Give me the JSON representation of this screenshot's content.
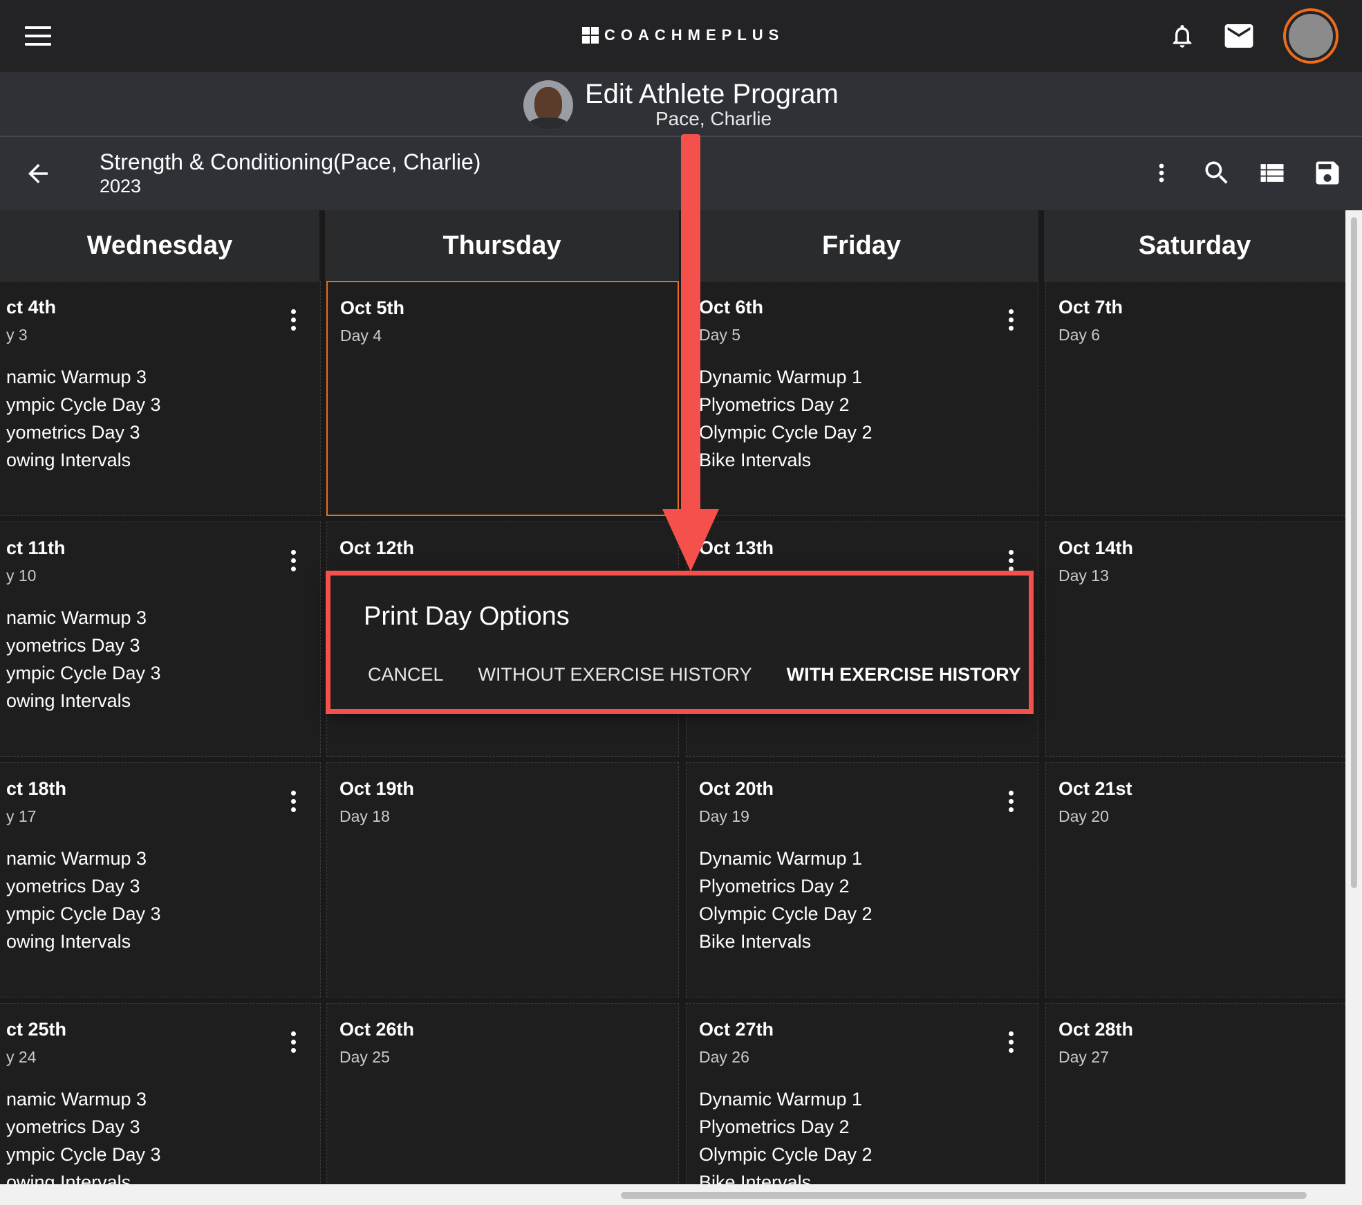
{
  "app": {
    "logo_text": "COACHMEPLUS"
  },
  "header": {
    "title": "Edit Athlete Program",
    "athlete_name": "Pace, Charlie"
  },
  "program": {
    "name": "Strength & Conditioning(Pace, Charlie)",
    "year": "2023"
  },
  "calendar": {
    "columns": [
      "Wednesday",
      "Thursday",
      "Friday",
      "Saturday"
    ],
    "weeks": [
      [
        {
          "date": "ct 4th",
          "day": "y 3",
          "items": [
            "namic Warmup 3",
            "ympic Cycle Day 3",
            "yometrics Day 3",
            "owing Intervals"
          ]
        },
        {
          "date": "Oct 5th",
          "day": "Day 4",
          "items": []
        },
        {
          "date": "Oct 6th",
          "day": "Day 5",
          "items": [
            "Dynamic Warmup 1",
            "Plyometrics Day 2",
            "Olympic Cycle Day 2",
            "Bike Intervals"
          ]
        },
        {
          "date": "Oct 7th",
          "day": "Day 6",
          "items": []
        }
      ],
      [
        {
          "date": "ct 11th",
          "day": "y 10",
          "items": [
            "namic Warmup 3",
            "yometrics Day 3",
            "ympic Cycle Day 3",
            "owing Intervals"
          ]
        },
        {
          "date": "Oct 12th",
          "day": "",
          "items": []
        },
        {
          "date": "Oct 13th",
          "day": "",
          "items": []
        },
        {
          "date": "Oct 14th",
          "day": "Day 13",
          "items": []
        }
      ],
      [
        {
          "date": "ct 18th",
          "day": "y 17",
          "items": [
            "namic Warmup 3",
            "yometrics Day 3",
            "ympic Cycle Day 3",
            "owing Intervals"
          ]
        },
        {
          "date": "Oct 19th",
          "day": "Day 18",
          "items": []
        },
        {
          "date": "Oct 20th",
          "day": "Day 19",
          "items": [
            "Dynamic Warmup 1",
            "Plyometrics Day 2",
            "Olympic Cycle Day 2",
            "Bike Intervals"
          ]
        },
        {
          "date": "Oct 21st",
          "day": "Day 20",
          "items": []
        }
      ],
      [
        {
          "date": "ct 25th",
          "day": "y 24",
          "items": [
            "namic Warmup 3",
            "yometrics Day 3",
            "ympic Cycle Day 3",
            "owing Intervals"
          ]
        },
        {
          "date": "Oct 26th",
          "day": "Day 25",
          "items": []
        },
        {
          "date": "Oct 27th",
          "day": "Day 26",
          "items": [
            "Dynamic Warmup 1",
            "Plyometrics Day 2",
            "Olympic Cycle Day 2",
            "Bike Intervals"
          ]
        },
        {
          "date": "Oct 28th",
          "day": "Day 27",
          "items": []
        }
      ]
    ]
  },
  "dialog": {
    "title": "Print Day Options",
    "cancel_label": "CANCEL",
    "without_label": "WITHOUT EXERCISE HISTORY",
    "with_label": "WITH EXERCISE HISTORY"
  },
  "colors": {
    "accent": "#ef6c1a",
    "annotation": "#f5504b",
    "topbar": "#232325",
    "panel": "#2f3136"
  },
  "icons": {
    "menu": "menu-icon",
    "bell": "bell-icon",
    "mail": "mail-icon",
    "back": "arrow-left-icon",
    "more": "more-vert-icon",
    "search": "search-icon",
    "list": "list-view-icon",
    "save": "save-icon"
  }
}
